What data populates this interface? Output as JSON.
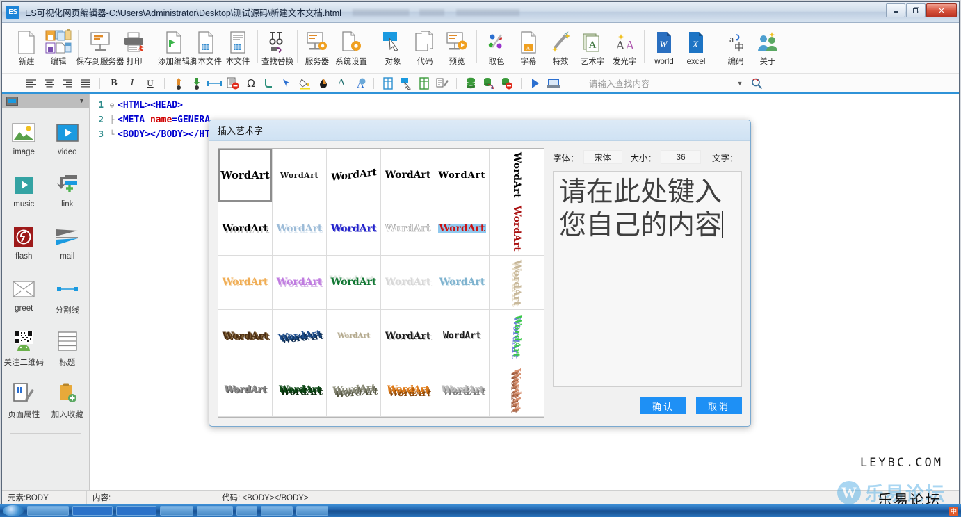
{
  "window": {
    "badge": "ES",
    "title": "ES可视化网页编辑器-C:\\Users\\Administrator\\Desktop\\测试源码\\新建文本文档.html",
    "minimize": "–",
    "maximize": "❐",
    "close": "✕"
  },
  "toolbar_main": [
    {
      "label": "新建",
      "icon": "new-document-icon"
    },
    {
      "label": "编辑",
      "icon": "edit-clipboard-icon"
    },
    {
      "label": "保存到服务器",
      "icon": "save-to-server-icon"
    },
    {
      "label": "打印",
      "icon": "print-icon"
    },
    {
      "label": "添加编辑",
      "icon": "add-edit-icon"
    },
    {
      "label": "脚本文件",
      "icon": "script-file-icon"
    },
    {
      "label": "本文件",
      "icon": "this-file-icon"
    },
    {
      "label": "查找替换",
      "icon": "find-replace-icon"
    },
    {
      "label": "服务器",
      "icon": "server-settings-icon"
    },
    {
      "label": "系统设置",
      "icon": "system-settings-icon"
    },
    {
      "label": "对象",
      "icon": "object-cursor-icon"
    },
    {
      "label": "代码",
      "icon": "code-pages-icon"
    },
    {
      "label": "预览",
      "icon": "preview-play-icon"
    },
    {
      "label": "取色",
      "icon": "color-picker-icon"
    },
    {
      "label": "字幕",
      "icon": "subtitle-icon"
    },
    {
      "label": "特效",
      "icon": "special-effect-wand-icon"
    },
    {
      "label": "艺术字",
      "icon": "wordart-icon"
    },
    {
      "label": "发光字",
      "icon": "glow-text-icon"
    },
    {
      "label": "world",
      "icon": "word-doc-icon"
    },
    {
      "label": "excel",
      "icon": "excel-doc-icon"
    },
    {
      "label": "编码",
      "icon": "encoding-icon"
    },
    {
      "label": "关于",
      "icon": "about-users-icon"
    }
  ],
  "toolbar_second": {
    "icons": [
      "align-left-icon",
      "align-center-icon",
      "align-right-icon",
      "align-justify-icon",
      "bold-icon",
      "italic-icon",
      "underline-icon",
      "move-up-icon",
      "move-down-icon",
      "horizontal-rule-icon",
      "delete-block-icon",
      "special-char-icon",
      "anchor-icon",
      "marquee-icon",
      "fill-color-icon",
      "ink-drop-icon",
      "font-color-icon",
      "font-style-icon",
      "table-insert-icon",
      "select-pointer-icon",
      "table-row-icon",
      "table-edit-icon",
      "database-icon",
      "database-sync-icon",
      "database-delete-icon",
      "run-icon",
      "browser-preview-icon"
    ],
    "bold_label": "B",
    "italic_label": "I",
    "underline_label": "U",
    "omega_label": "Ω",
    "font_a_label": "A",
    "search_placeholder": "请输入查找内容"
  },
  "sidepanel": {
    "header_icon": "panel-window-icon",
    "header_caret": "▼",
    "items": [
      {
        "label": "image",
        "icon": "image-icon"
      },
      {
        "label": "video",
        "icon": "video-icon"
      },
      {
        "label": "music",
        "icon": "music-icon"
      },
      {
        "label": "link",
        "icon": "link-icon"
      },
      {
        "label": "flash",
        "icon": "flash-icon"
      },
      {
        "label": "mail",
        "icon": "mail-send-icon"
      },
      {
        "label": "greet",
        "icon": "greet-envelope-icon"
      },
      {
        "label": "分割线",
        "icon": "divider-line-icon"
      },
      {
        "label": "关注二维码",
        "icon": "qrcode-android-icon"
      },
      {
        "label": "标题",
        "icon": "heading-icon"
      },
      {
        "label": "页面属性",
        "icon": "page-properties-icon"
      },
      {
        "label": "加入收藏",
        "icon": "add-favorite-icon"
      }
    ]
  },
  "editor": {
    "lines": [
      {
        "number": "1",
        "fold": "⊖",
        "html": "<span class='tag'>&lt;HTML&gt;&lt;HEAD&gt;</span>"
      },
      {
        "number": "2",
        "fold": "",
        "html": "<span class='tag'>&lt;META </span><span class='attr'>name</span><span class='tag'>=</span><span class='val'>GENERA</span>"
      },
      {
        "number": "3",
        "fold": "",
        "html": "<span class='tag'>&lt;BODY&gt;&lt;/BODY&gt;&lt;/HT</span>"
      }
    ],
    "line1_plain": "<HTML><HEAD>",
    "line2_plain": "<META name=GENERA",
    "line3_plain": "<BODY></BODY></HT"
  },
  "dialog": {
    "title": "插入艺术字",
    "font_label": "字体：",
    "font_value": "宋体",
    "size_label": "大小：",
    "size_value": "36",
    "text_label": "文字：",
    "text_value": "请在此处键入您自己的内容",
    "confirm_label": "确认",
    "cancel_label": "取消",
    "wordart_text": "WordArt",
    "styles": [
      {
        "id": 1,
        "color": "#000000",
        "desc": "plain-black",
        "selected": true
      },
      {
        "id": 2,
        "color": "#111111",
        "desc": "small-arc-black",
        "selected": false
      },
      {
        "id": 3,
        "color": "#000000",
        "desc": "wave-black",
        "selected": false
      },
      {
        "id": 4,
        "color": "#000000",
        "desc": "bold-black",
        "selected": false
      },
      {
        "id": 5,
        "color": "#000000",
        "desc": "spread-black",
        "selected": false
      },
      {
        "id": 6,
        "color": "#000000",
        "desc": "vertical-black",
        "selected": false
      },
      {
        "id": 7,
        "color": "#000000",
        "desc": "shadow-black",
        "selected": false
      },
      {
        "id": 8,
        "color": "#9dbcd8",
        "desc": "light-blue",
        "selected": false
      },
      {
        "id": 9,
        "color": "#2222cc",
        "desc": "solid-blue",
        "selected": false
      },
      {
        "id": 10,
        "color": "#bfbfbf",
        "desc": "outline-gray",
        "selected": false
      },
      {
        "id": 11,
        "color": "#cc1111",
        "desc": "red-on-blue",
        "selected": false
      },
      {
        "id": 12,
        "color": "#aa1111",
        "desc": "vertical-red",
        "selected": false
      },
      {
        "id": 13,
        "color": "#f0ad54",
        "desc": "orange-fade",
        "selected": false
      },
      {
        "id": 14,
        "color": "#c07ce0",
        "desc": "purple-shadow",
        "selected": false
      },
      {
        "id": 15,
        "color": "#117733",
        "desc": "green-shadow",
        "selected": false
      },
      {
        "id": 16,
        "color": "#d8d8d8",
        "desc": "faint-gray",
        "selected": false
      },
      {
        "id": 17,
        "color": "#7fb3cf",
        "desc": "teal-gradient",
        "selected": false
      },
      {
        "id": 18,
        "color": "#c8b89a",
        "desc": "vertical-tan",
        "selected": false
      },
      {
        "id": 19,
        "color": "#4a2d12",
        "desc": "brown-3d",
        "selected": false
      },
      {
        "id": 20,
        "color": "#1f4f8f",
        "desc": "blue-3d-slant",
        "selected": false
      },
      {
        "id": 21,
        "color": "#b5ab90",
        "desc": "small-khaki",
        "selected": false
      },
      {
        "id": 22,
        "color": "#1a1a1a",
        "desc": "bold-shadow-black",
        "selected": false
      },
      {
        "id": 23,
        "color": "#1a1a1a",
        "desc": "mono-black",
        "selected": false
      },
      {
        "id": 24,
        "color": "#3ac84a",
        "desc": "vertical-green-blue",
        "selected": false
      },
      {
        "id": 25,
        "color": "#8a8a8a",
        "desc": "gray-3d",
        "selected": false
      },
      {
        "id": 26,
        "color": "#0d4a16",
        "desc": "dark-green-3d",
        "selected": false
      },
      {
        "id": 27,
        "color": "#8b8c78",
        "desc": "olive-3d",
        "selected": false
      },
      {
        "id": 28,
        "color": "#e07b18",
        "desc": "orange-3d",
        "selected": false
      },
      {
        "id": 29,
        "color": "#bdbdbd",
        "desc": "silver-3d",
        "selected": false
      },
      {
        "id": 30,
        "color": "#d79070",
        "desc": "copper-vertical-3d",
        "selected": false
      }
    ]
  },
  "statusbar": {
    "element": "元素:BODY",
    "content": "内容:",
    "code": "代码: <BODY></BODY>"
  },
  "watermark": {
    "domain": "LEYBC.COM",
    "forum": "乐易论坛",
    "logo_letter": "W",
    "logo_text": "乐易论坛"
  },
  "taskbar": {
    "ime": "中",
    "clock": ""
  }
}
